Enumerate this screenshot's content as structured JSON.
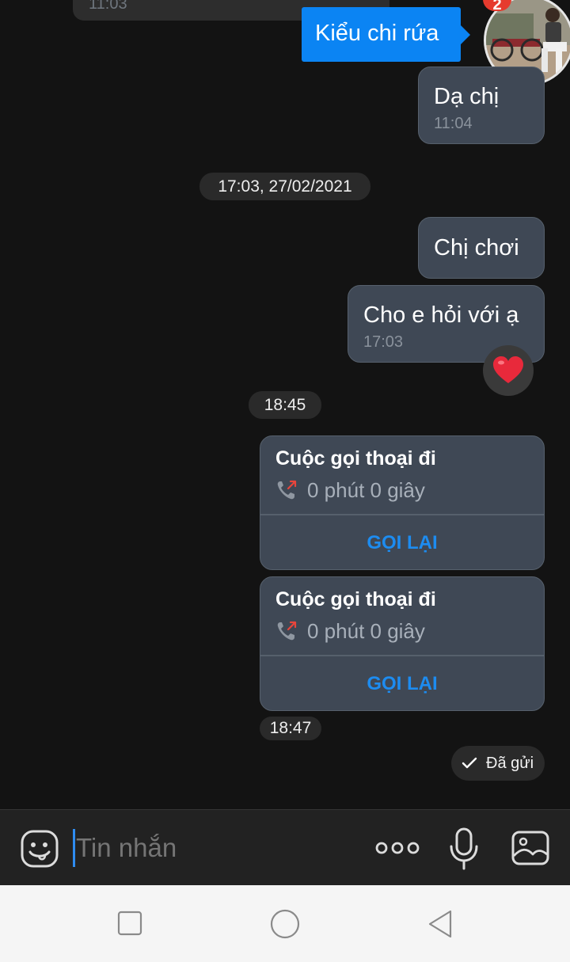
{
  "chat": {
    "top_partial_time": "11:03",
    "popup": {
      "text": "Kiểu chi rứa",
      "badge": "2"
    },
    "msg_da_chi": {
      "text": "Dạ chị",
      "time": "11:04"
    },
    "date_divider": "17:03, 27/02/2021",
    "msg_chi_choi": {
      "text": "Chị chơi"
    },
    "msg_cho_e_hoi": {
      "text": "Cho e hỏi với ạ",
      "time": "17:03",
      "reaction": "heart-reaction-icon"
    },
    "time_divider_1": "18:45",
    "calls": [
      {
        "title": "Cuộc gọi thoại đi",
        "duration": "0 phút 0 giây",
        "action": "GỌI LẠI"
      },
      {
        "title": "Cuộc gọi thoại đi",
        "duration": "0 phút 0 giây",
        "action": "GỌI LẠI"
      }
    ],
    "time_divider_2": "18:47",
    "status": "Đã gửi"
  },
  "composer": {
    "placeholder": "Tin nhắn",
    "icons": [
      "sticker-icon",
      "more-icon",
      "microphone-icon",
      "image-icon"
    ]
  },
  "system_nav": {
    "icons": [
      "recent-apps-icon",
      "home-icon",
      "back-icon"
    ]
  },
  "colors": {
    "background": "#131313",
    "bubble": "#3f4855",
    "accent_blue": "#1d8cf0",
    "popup_blue": "#0b84f3",
    "badge_red": "#e63b2e",
    "heart": "#e8293b"
  }
}
